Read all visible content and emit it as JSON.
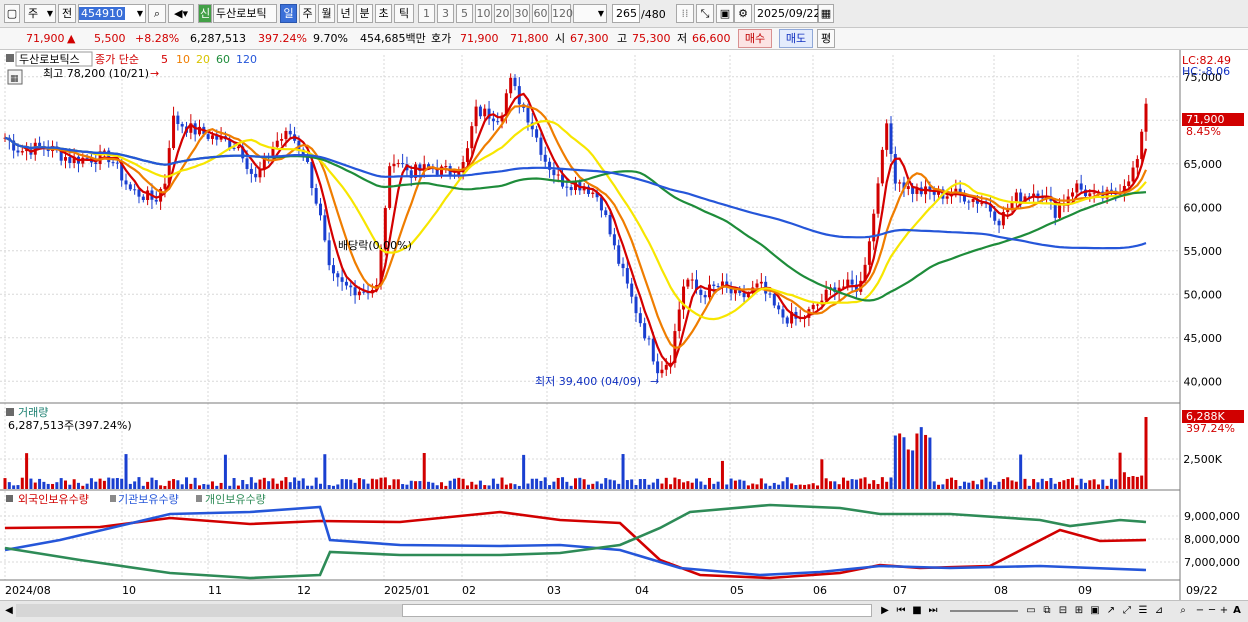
{
  "toolbar": {
    "market_select": "주",
    "compare_select": "전",
    "code_input": "454910",
    "stock_name_badge": "신",
    "stock_name": "두산로보틱",
    "period_tabs": [
      "일",
      "주",
      "월",
      "년",
      "분",
      "초",
      "틱"
    ],
    "interval_buttons": [
      "1",
      "3",
      "5",
      "10",
      "20",
      "30",
      "60",
      "120"
    ],
    "view_count": "265",
    "view_total": "/480",
    "date_input": "2025/09/22"
  },
  "quote": {
    "price": "71,900",
    "change_arrow": "▲",
    "change": "5,500",
    "change_pct": "+8.28%",
    "volume": "6,287,513",
    "volume_ratio": "397.24%",
    "turnover": "9.70%",
    "amount": "454,685백만",
    "hoga_label": "호가",
    "ask": "71,900",
    "bid": "71,800",
    "open_label": "시",
    "open": "67,300",
    "high_label": "고",
    "high": "75,300",
    "low_label": "저",
    "low": "66,600",
    "buy_button": "매수",
    "sell_button": "매도",
    "eval_button": "평"
  },
  "price_panel": {
    "series_label": "두산로보틱스",
    "legend_prefix": "종가 단순",
    "ma_periods": [
      "5",
      "10",
      "20",
      "60",
      "120"
    ],
    "ma_colors": [
      "#d40000",
      "#ef7d00",
      "#f7e600",
      "#1e8c3a",
      "#2556d9"
    ],
    "max_marker": "최고 78,200 (10/21)",
    "min_marker": "최저 39,400 (04/09)",
    "dividend_marker": "배당락(0.00%)",
    "lc_label": "LC:82.49",
    "hc_label": "HC:-8.06",
    "last_price_tag": "71,900",
    "last_pct_tag": "8.45%",
    "price_axis": [
      "75,000",
      "70,000",
      "65,000",
      "60,000",
      "55,000",
      "50,000",
      "45,000",
      "40,000"
    ]
  },
  "volume_panel": {
    "title": "거래량",
    "value": "6,287,513주(397.24%)",
    "tag_value": "6,288K",
    "tag_pct": "397.24%",
    "axis": [
      "2,500K"
    ]
  },
  "holdings_panel": {
    "legends": [
      "외국인보유수량",
      "기관보유수량",
      "개인보유수량"
    ],
    "colors": [
      "#d10000",
      "#2556d9",
      "#2e8b57"
    ],
    "axis": [
      "9,000,000",
      "8,000,000",
      "7,000,000"
    ]
  },
  "date_axis": [
    "2024/08",
    "10",
    "11",
    "12",
    "2025/01",
    "02",
    "03",
    "04",
    "05",
    "06",
    "07",
    "08",
    "09",
    "09/22"
  ],
  "chart_data": {
    "type": "candlestick",
    "price_range": [
      37500,
      77500
    ],
    "key_points": [
      {
        "date": "10/21",
        "label": "high",
        "value": 78200
      },
      {
        "date": "04/09",
        "label": "low",
        "value": 39400
      },
      {
        "date": "09/22",
        "label": "last",
        "value": 71900
      }
    ]
  }
}
